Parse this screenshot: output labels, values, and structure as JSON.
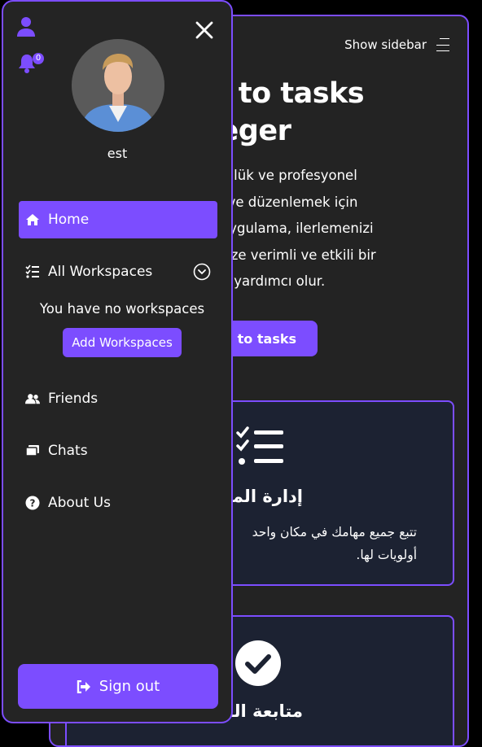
{
  "main": {
    "show_sidebar_label": "Show sidebar",
    "hero_title": "me to tasks\naneger",
    "hero_text": "ası, günlük ve profesyonel\netmek ve düzenlemek için\nndür. Uygulama, ilerlemenizi\nleflerinize verimli ve etkili bir\nmanıza yardımcı olur.",
    "hero_button": "o to tasks",
    "cards": [
      {
        "icon": "checklist-icon",
        "title": "إدارة المهام",
        "text": "تتبع جميع مهامك في مكان واحد\nأولويات لها."
      },
      {
        "icon": "check-circle-icon",
        "title": "متابعة التقدم"
      }
    ]
  },
  "sidebar": {
    "badge_count": "0",
    "username": "est",
    "nav": {
      "home": "Home",
      "workspaces": "All Workspaces",
      "friends": "Friends",
      "chats": "Chats",
      "about": "About Us"
    },
    "no_workspaces": "You have no workspaces",
    "add_workspaces": "Add Workspaces",
    "sign_out": "Sign out"
  },
  "colors": {
    "accent": "#7c4dff",
    "panel": "#242424",
    "card": "#1c2232"
  }
}
